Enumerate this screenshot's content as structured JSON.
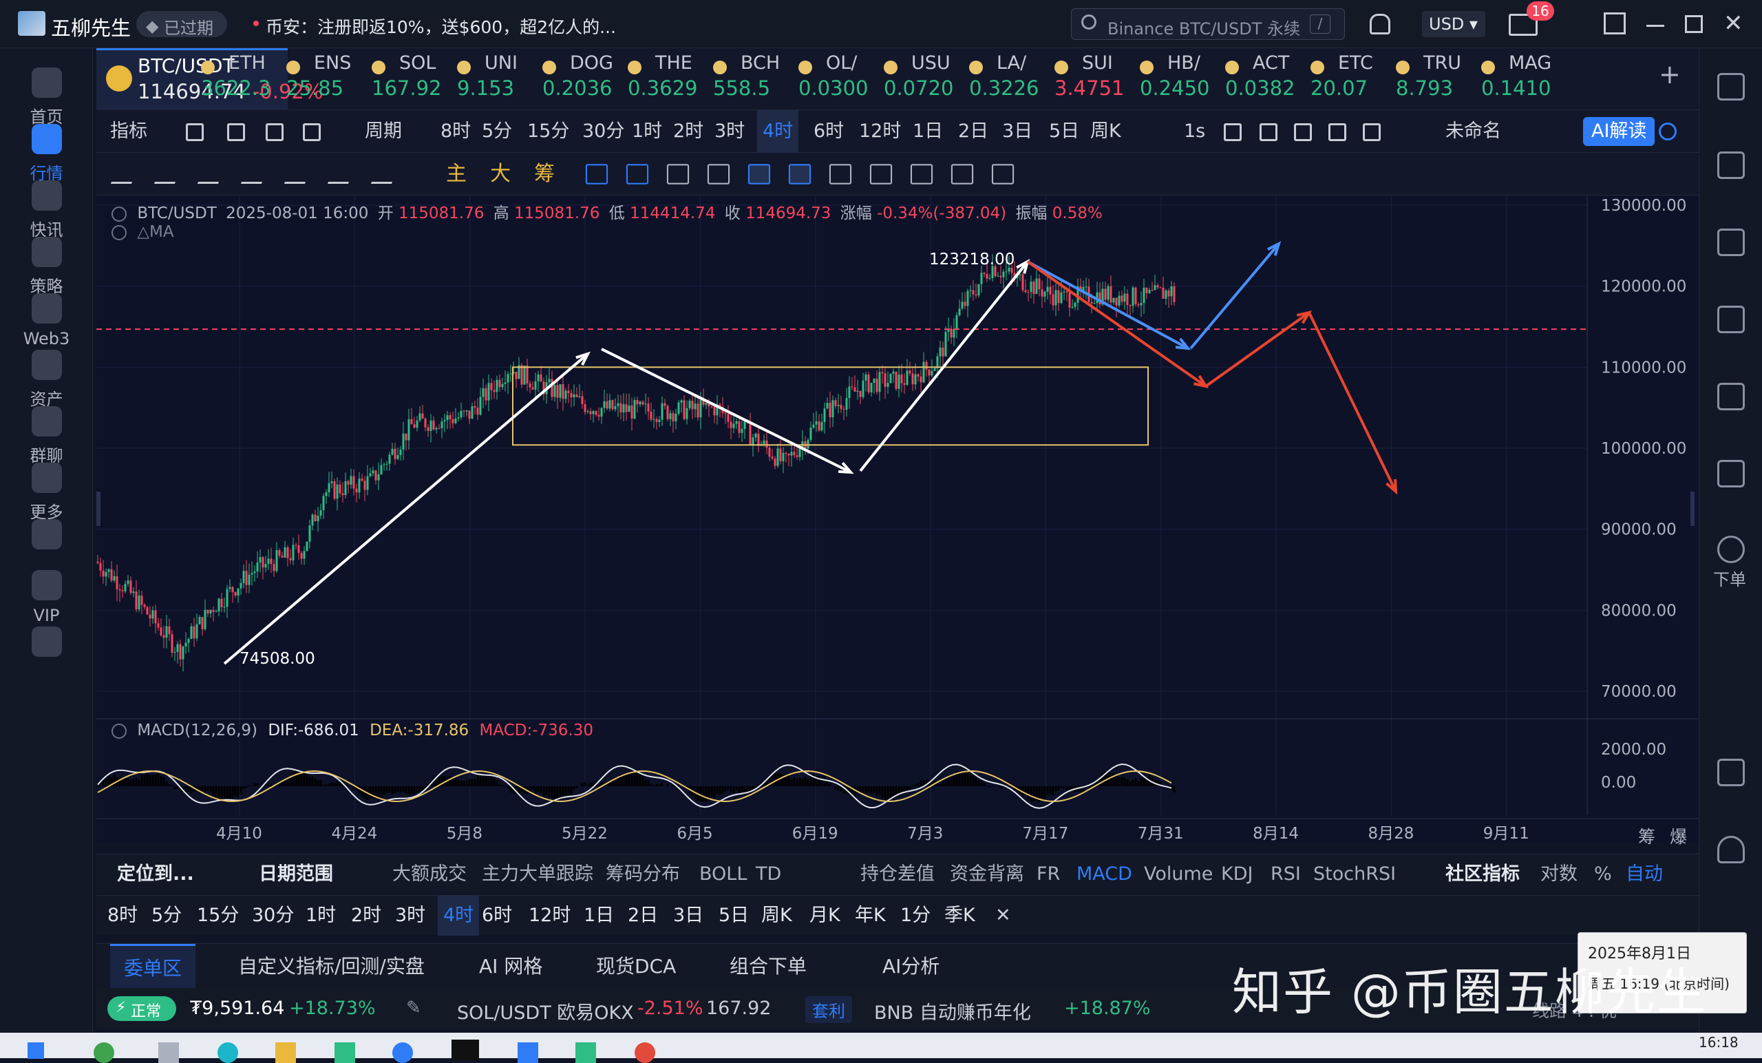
{
  "app": {
    "name": "五柳先生",
    "badge": "已过期",
    "news": "币安：注册即返10%，送$600，超2亿人的...",
    "search_placeholder": "Binance BTC/USDT 永续",
    "currency": "USD",
    "msg_count": "16"
  },
  "nav": [
    {
      "label": "首页",
      "icon": "home-icon"
    },
    {
      "label": "行情",
      "icon": "market-icon"
    },
    {
      "label": "快讯",
      "icon": "news-icon"
    },
    {
      "label": "策略",
      "icon": "strategy-icon"
    },
    {
      "label": "Web3",
      "icon": "web3-icon"
    },
    {
      "label": "资产",
      "icon": "wallet-icon"
    },
    {
      "label": "群聊",
      "icon": "chat-icon"
    },
    {
      "label": "更多",
      "icon": "more-icon"
    },
    {
      "label": "",
      "icon": "tablet-icon"
    },
    {
      "label": "VIP",
      "icon": "vip-icon"
    },
    {
      "label": "",
      "icon": "settings-icon"
    }
  ],
  "right_nav": {
    "order_label": "下单"
  },
  "tickers": [
    {
      "name": "BTC/USDT",
      "price": "114694.74",
      "chg": "-0.92%",
      "color": "#e9e9e9"
    },
    {
      "name": "ETH",
      "price": "3622.3",
      "color": "#2ebd85"
    },
    {
      "name": "ENS",
      "price": "25.85",
      "color": "#2ebd85"
    },
    {
      "name": "SOL",
      "price": "167.92",
      "color": "#2ebd85"
    },
    {
      "name": "UNI",
      "price": "9.153",
      "color": "#2ebd85"
    },
    {
      "name": "DOG",
      "price": "0.2036",
      "color": "#2ebd85"
    },
    {
      "name": "THE",
      "price": "0.3629",
      "color": "#2ebd85"
    },
    {
      "name": "BCH",
      "price": "558.5",
      "color": "#2ebd85"
    },
    {
      "name": "OL/",
      "price": "0.0300",
      "color": "#2ebd85"
    },
    {
      "name": "USU",
      "price": "0.0720",
      "color": "#2ebd85"
    },
    {
      "name": "LA/",
      "price": "0.3226",
      "color": "#2ebd85"
    },
    {
      "name": "SUI",
      "price": "3.4751",
      "color": "#f6465d"
    },
    {
      "name": "HB/",
      "price": "0.2450",
      "color": "#2ebd85"
    },
    {
      "name": "ACT",
      "price": "0.0382",
      "color": "#2ebd85"
    },
    {
      "name": "ETC",
      "price": "20.07",
      "color": "#2ebd85"
    },
    {
      "name": "TRU",
      "price": "8.793",
      "color": "#2ebd85"
    },
    {
      "name": "MAG",
      "price": "0.1410",
      "color": "#2ebd85"
    }
  ],
  "toolbar1": [
    "指标",
    "",
    "",
    "",
    "",
    "周期",
    "8时",
    "5分",
    "15分",
    "30分",
    "1时",
    "2时",
    "3时",
    "4时",
    "6时",
    "12时",
    "1日",
    "2日",
    "3日",
    "5日",
    "周K",
    "1s",
    "",
    "",
    "",
    "",
    "",
    "未命名",
    "AI解读"
  ],
  "toolbar2_labels": [
    "主",
    "大",
    "筹"
  ],
  "chart": {
    "info": {
      "symbol": "BTC/USDT",
      "date": "2025-08-01 16:00",
      "open_label": "开",
      "open": "115081.76",
      "high_label": "高",
      "high": "115081.76",
      "low_label": "低",
      "low": "114414.74",
      "close_label": "收",
      "close": "114694.73",
      "chg_label": "涨幅",
      "chg": "-0.34%(-387.04)",
      "amp_label": "振幅",
      "amp": "0.58%"
    },
    "ma_label": "MA",
    "macd_label": "MACD(12,26,9)",
    "dif": "DIF:-686.01",
    "dea": "DEA:-317.86",
    "macd": "MACD:-736.30",
    "high_mark": "123218.00",
    "low_mark": "74508.00",
    "yticks": [
      "130000.00",
      "120000.00",
      "110000.00",
      "100000.00",
      "90000.00",
      "80000.00",
      "70000.00"
    ],
    "macd_ticks": [
      "2000.00",
      "0.00"
    ],
    "xticks": [
      "4月10",
      "4月24",
      "5月8",
      "5月22",
      "6月5",
      "6月19",
      "7月3",
      "7月17",
      "7月31",
      "8月14",
      "8月28",
      "9月11"
    ],
    "corner": [
      "筹",
      "爆"
    ]
  },
  "chart_data": {
    "type": "candlestick",
    "title": "BTC/USDT",
    "interval": "4时",
    "ylim": [
      70000,
      130000
    ],
    "x": [
      "4月10",
      "4月24",
      "5月8",
      "5月22",
      "6月5",
      "6月19",
      "7月3",
      "7月17",
      "7月31"
    ],
    "close": [
      79000,
      93000,
      103000,
      110000,
      105000,
      102000,
      109000,
      118000,
      115000
    ],
    "current": 114694.73
  },
  "bottom1": [
    "定位到...",
    "日期范围",
    "大额成交",
    "主力大单跟踪",
    "筹码分布",
    "BOLL",
    "TD",
    "持仓差值",
    "资金背离",
    "FR",
    "MACD",
    "Volume",
    "KDJ",
    "RSI",
    "StochRSI",
    "社区指标",
    "对数",
    "%",
    "自动"
  ],
  "bottom2": [
    "8时",
    "5分",
    "15分",
    "30分",
    "1时",
    "2时",
    "3时",
    "4时",
    "6时",
    "12时",
    "1日",
    "2日",
    "3日",
    "5日",
    "周K",
    "月K",
    "年K",
    "1分",
    "季K"
  ],
  "tabs3": [
    "委单区",
    "自定义指标/回测/实盘",
    "AI 网格",
    "现货DCA",
    "组合下单",
    "AI分析"
  ],
  "status": {
    "state": "正常",
    "balance": "₮9,591.64",
    "balance_chg": "+18.73%",
    "pair": "SOL/USDT 欧易OKX",
    "pair_chg": "-2.51%",
    "pair_px": "167.92",
    "arb": "套利",
    "earn": "BNB 自动赚币年化",
    "earn_pct": "+18.87%",
    "line": "线路 4 : 优"
  },
  "tooltip": {
    "date": "2025年8月1日",
    "time": "周五 16:19 (北京时间)"
  },
  "watermark": "知乎 @币圈五柳先生",
  "taskbar_time": "16:18"
}
